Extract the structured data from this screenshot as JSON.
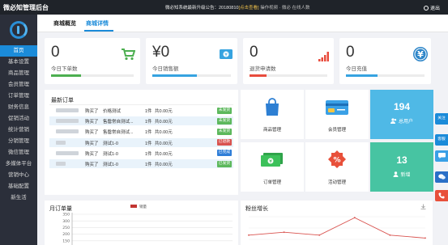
{
  "topbar": {
    "title": "微必知管理后台",
    "notice_prefix": "微必知系统最新升级公告：20180810",
    "notice_highlight": "[点击查看]",
    "notice_suffix": " 操作视频 · 微必 在线人数",
    "exit_label": "退出"
  },
  "sidebar": {
    "items": [
      "首页",
      "基本设置",
      "商品管理",
      "会员管理",
      "订单管理",
      "财务信息",
      "促销活动",
      "统计营销",
      "分销管理",
      "微信管理",
      "多媒体平台",
      "营销中心",
      "基础配置",
      "新生活"
    ]
  },
  "tabs": {
    "overview": "商城概览",
    "detail": "商城详情"
  },
  "stats": [
    {
      "value": "0",
      "label": "今日下单数",
      "icon": "cart-icon",
      "color": "#4caf50",
      "fill": 0.36
    },
    {
      "value": "¥0",
      "label": "今日销售额",
      "icon": "banknote-icon",
      "color": "#36a3e0",
      "fill": 0.57
    },
    {
      "value": "0",
      "label": "退货申请数",
      "icon": "signal-bars-icon",
      "color": "#e84c3d",
      "fill": 0.22
    },
    {
      "value": "0",
      "label": "今日充值",
      "icon": "yen-circle-icon",
      "color": "#36a3e0",
      "fill": 0.4
    }
  ],
  "orders": {
    "title": "最新订单",
    "rows": [
      {
        "action": "购买了",
        "product": "价格测试",
        "qty": "1件",
        "price": "共0.00元",
        "status": "未发货",
        "color": "#5cb85c",
        "alt": false
      },
      {
        "action": "购买了",
        "product": "售罄常自测试...",
        "qty": "1件",
        "price": "共0.00元",
        "status": "未发货",
        "color": "#5cb85c",
        "alt": true
      },
      {
        "action": "购买了",
        "product": "售罄常自测试...",
        "qty": "1件",
        "price": "共0.00元",
        "status": "未发货",
        "color": "#5cb85c",
        "alt": false
      },
      {
        "action": "购买了",
        "product": "测试1-0",
        "qty": "1件",
        "price": "共0.00元",
        "status": "已退款",
        "color": "#d9534f",
        "alt": true
      },
      {
        "action": "购买了",
        "product": "测试1-0",
        "qty": "1件",
        "price": "共0.00元",
        "status": "已完成",
        "color": "#2f7ed8",
        "alt": false
      },
      {
        "action": "购买了",
        "product": "测试1-0",
        "qty": "1件",
        "price": "共0.00元",
        "status": "已发货",
        "color": "#5cb85c",
        "alt": true
      }
    ]
  },
  "tiles": {
    "goods": "商品管理",
    "members": "会员管理",
    "orders": "订单管理",
    "activity": "活动管理",
    "total_users_value": "194",
    "total_users_label": "总用户",
    "new_value": "13",
    "new_label": "新增"
  },
  "charts": {
    "monthly_title": "月订单量",
    "monthly_legend": "销量",
    "fans_title": "粉丝增长"
  },
  "floats": [
    "关注",
    "客服"
  ],
  "chart_data": [
    {
      "type": "bar",
      "title": "月订单量",
      "series": [
        {
          "name": "销量",
          "values": []
        }
      ],
      "ylim": [
        0,
        350
      ],
      "yticks": [
        350,
        300,
        250,
        200,
        150
      ]
    },
    {
      "type": "line",
      "title": "粉丝增长",
      "series": [
        {
          "values": [
            11,
            12,
            11,
            17,
            11,
            10
          ]
        }
      ],
      "ylim": [
        4,
        19
      ]
    }
  ]
}
